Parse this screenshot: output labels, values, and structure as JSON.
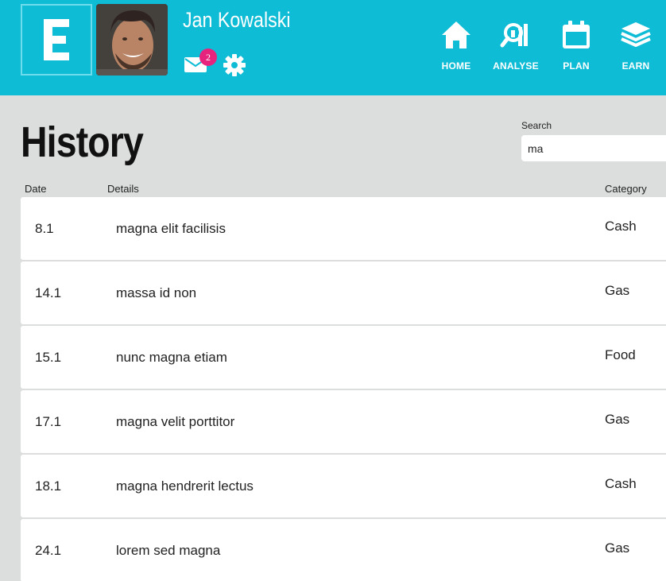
{
  "brand": {
    "logo_letter": "E"
  },
  "user": {
    "name": "Jan Kowalski",
    "unread_messages": "2"
  },
  "nav": [
    {
      "label": "HOME",
      "icon": "home-icon"
    },
    {
      "label": "ANALYSE",
      "icon": "analyse-icon"
    },
    {
      "label": "PLAN",
      "icon": "calendar-icon"
    },
    {
      "label": "EARN",
      "icon": "layers-icon"
    }
  ],
  "page": {
    "title": "History"
  },
  "search": {
    "label": "Search",
    "value": "ma"
  },
  "table": {
    "columns": {
      "date": "Date",
      "details": "Details",
      "category": "Category"
    },
    "rows": [
      {
        "date": "8.1",
        "details": "magna elit facilisis",
        "category": "Cash"
      },
      {
        "date": "14.1",
        "details": "massa id non",
        "category": "Gas"
      },
      {
        "date": "15.1",
        "details": "nunc magna etiam",
        "category": "Food"
      },
      {
        "date": "17.1",
        "details": "magna velit porttitor",
        "category": "Gas"
      },
      {
        "date": "18.1",
        "details": "magna hendrerit lectus",
        "category": "Cash"
      },
      {
        "date": "24.1",
        "details": "lorem sed magna",
        "category": "Gas"
      }
    ]
  },
  "colors": {
    "header": "#0fbcd5",
    "background": "#dcdedd",
    "badge": "#e6247d"
  }
}
